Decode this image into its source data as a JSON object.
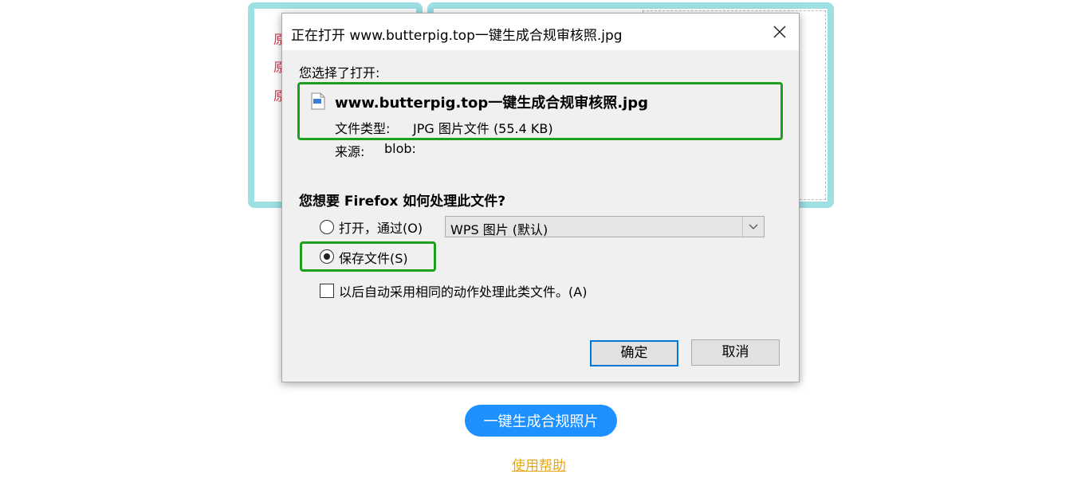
{
  "background": {
    "lines": [
      "原",
      "原",
      "原"
    ],
    "primary_button": "一键生成合规照片",
    "help_link": "使用帮助"
  },
  "dialog": {
    "title": "正在打开 www.butterpig.top一键生成合规审核照.jpg",
    "selected_label": "您选择了打开:",
    "file_name": "www.butterpig.top一键生成合规审核照.jpg",
    "file_type_label": "文件类型:",
    "file_type_value": "JPG 图片文件 (55.4 KB)",
    "source_label": "来源:",
    "source_value": "blob:",
    "question": "您想要 Firefox 如何处理此文件?",
    "open_with_label": "打开，通过(O)",
    "open_with_app": "WPS 图片 (默认)",
    "save_file_label": "保存文件(S)",
    "remember_label": "以后自动采用相同的动作处理此类文件。(A)",
    "ok_button": "确定",
    "cancel_button": "取消",
    "selected_option": "save_file"
  },
  "colors": {
    "highlight_border": "#1ea01e",
    "card_border": "#9ddfe3",
    "primary_button_bg": "#1e90ff",
    "link": "#e6a817"
  }
}
